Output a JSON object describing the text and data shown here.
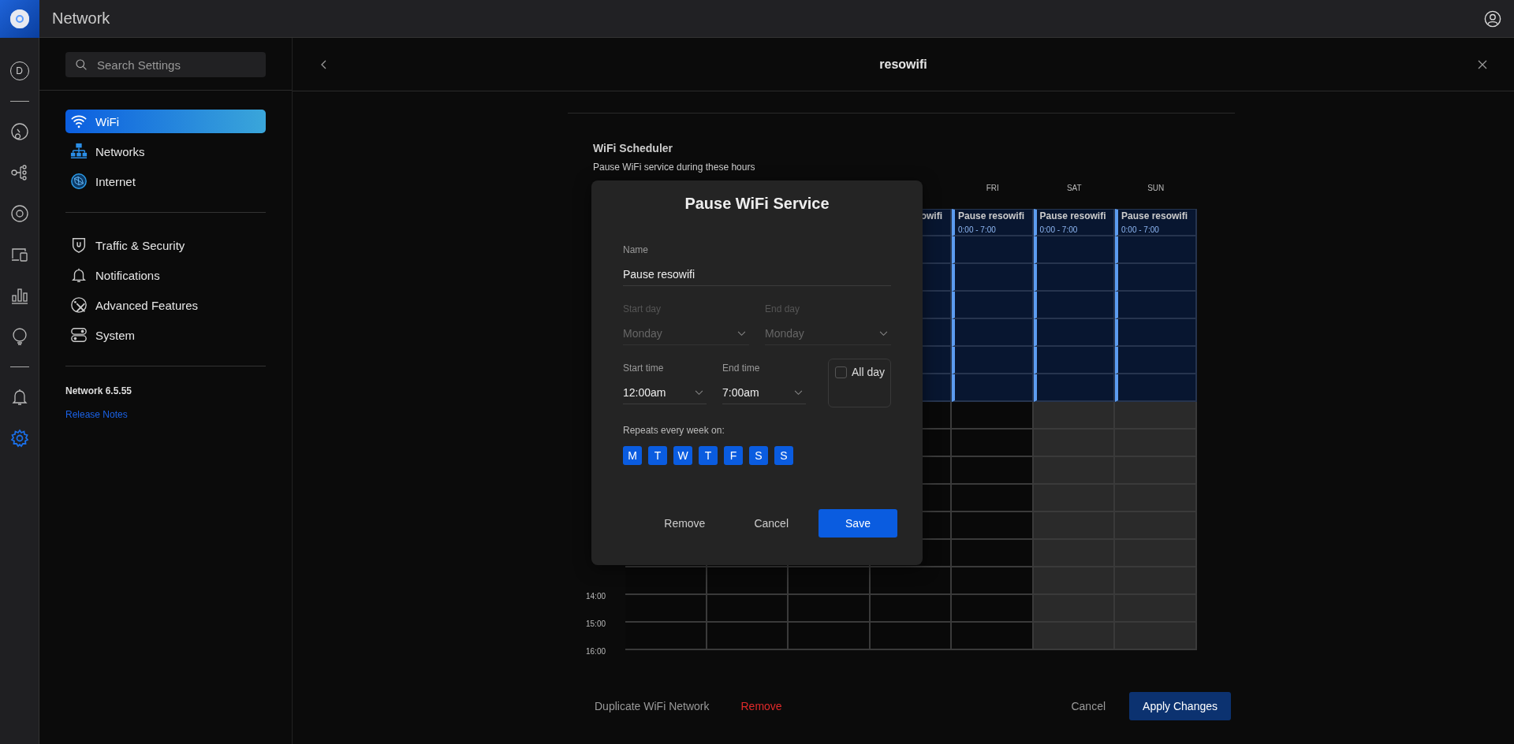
{
  "app": {
    "title": "Network"
  },
  "rail": [
    {
      "kind": "initial",
      "text": "D",
      "selected": false
    },
    {
      "kind": "divider"
    },
    {
      "kind": "dashboard",
      "selected": false
    },
    {
      "kind": "topology",
      "selected": false
    },
    {
      "kind": "device",
      "selected": false
    },
    {
      "kind": "clients",
      "selected": false
    },
    {
      "kind": "stats",
      "selected": false
    },
    {
      "kind": "insights",
      "selected": false
    },
    {
      "kind": "divider"
    },
    {
      "kind": "alerts",
      "selected": false
    },
    {
      "kind": "settings",
      "selected": true
    }
  ],
  "sidebar": {
    "search": {
      "placeholder": "Search Settings"
    },
    "groups": [
      [
        {
          "label": "WiFi",
          "selected": true
        },
        {
          "label": "Networks",
          "selected": false
        },
        {
          "label": "Internet",
          "selected": false
        }
      ],
      [
        {
          "label": "Traffic & Security",
          "selected": false
        },
        {
          "label": "Notifications",
          "selected": false
        },
        {
          "label": "Advanced Features",
          "selected": false
        },
        {
          "label": "System",
          "selected": false
        }
      ]
    ],
    "version": "Network 6.5.55",
    "release_notes": "Release Notes"
  },
  "header": {
    "title": "resowifi"
  },
  "scheduler": {
    "title": "WiFi Scheduler",
    "subtitle": "Pause WiFi service during these hours",
    "columns": [
      {
        "weekend": false
      },
      {
        "weekend": false
      },
      {
        "weekend": false
      },
      {
        "weekend": false,
        "event": {
          "kind": "cut",
          "title": "owifi"
        }
      },
      {
        "day": "FRI",
        "weekend": false,
        "event": {
          "kind": "full",
          "title": "Pause resowifi",
          "time": "0:00 - 7:00"
        }
      },
      {
        "day": "SAT",
        "weekend": true,
        "event": {
          "kind": "full",
          "title": "Pause resowifi",
          "time": "0:00 - 7:00"
        }
      },
      {
        "day": "SUN",
        "weekend": true,
        "event": {
          "kind": "full",
          "title": "Pause resowifi",
          "time": "0:00 - 7:00"
        }
      }
    ],
    "rows": [
      {
        "paused": true
      },
      {
        "paused": true
      },
      {
        "paused": true
      },
      {
        "paused": true
      },
      {
        "paused": true
      },
      {
        "paused": true
      },
      {
        "paused": true
      },
      {
        "paused": false
      },
      {
        "paused": false
      },
      {
        "paused": false
      },
      {
        "paused": false
      },
      {
        "paused": false
      },
      {
        "paused": false
      },
      {
        "paused": false,
        "label": "14:00"
      },
      {
        "paused": false,
        "label": "15:00"
      },
      {
        "paused": false,
        "label": "16:00"
      }
    ]
  },
  "dialog": {
    "title": "Pause WiFi Service",
    "name": {
      "label": "Name",
      "value": "Pause resowifi"
    },
    "start_day": {
      "label": "Start day",
      "value": "Monday",
      "disabled": true
    },
    "end_day": {
      "label": "End day",
      "value": "Monday",
      "disabled": true
    },
    "start_time": {
      "label": "Start time",
      "value": "12:00am",
      "disabled": false
    },
    "end_time": {
      "label": "End time",
      "value": "7:00am",
      "disabled": false
    },
    "all_day": {
      "label": "All day",
      "checked": false
    },
    "repeats_label": "Repeats every week on:",
    "days": [
      {
        "label": "M",
        "selected": true
      },
      {
        "label": "T",
        "selected": true
      },
      {
        "label": "W",
        "selected": true
      },
      {
        "label": "T",
        "selected": true
      },
      {
        "label": "F",
        "selected": true
      },
      {
        "label": "S",
        "selected": true
      },
      {
        "label": "S",
        "selected": true
      }
    ],
    "buttons": {
      "remove": "Remove",
      "cancel": "Cancel",
      "save": "Save"
    }
  },
  "footer": {
    "duplicate": "Duplicate WiFi Network",
    "remove": "Remove",
    "cancel": "Cancel",
    "apply": "Apply Changes"
  }
}
